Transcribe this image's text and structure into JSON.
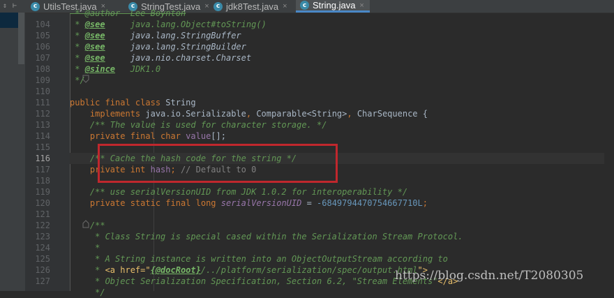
{
  "tabs": [
    {
      "label": "UtilsTest.java",
      "active": false
    },
    {
      "label": "StringTest.java",
      "active": false
    },
    {
      "label": "jdk8Test.java",
      "active": false
    },
    {
      "label": "String.java",
      "active": true
    }
  ],
  "toolstrip": {
    "icons": [
      "collapse-icon",
      "pin-icon"
    ]
  },
  "editor": {
    "current_line": "116",
    "lines": [
      {
        "n": "104"
      },
      {
        "n": "105"
      },
      {
        "n": "106"
      },
      {
        "n": "107"
      },
      {
        "n": "108"
      },
      {
        "n": "109"
      },
      {
        "n": "110"
      },
      {
        "n": "111"
      },
      {
        "n": "112"
      },
      {
        "n": "113"
      },
      {
        "n": "114"
      },
      {
        "n": "115"
      },
      {
        "n": "116"
      },
      {
        "n": "117"
      },
      {
        "n": "118"
      },
      {
        "n": "119"
      },
      {
        "n": "120"
      },
      {
        "n": "121"
      },
      {
        "n": "122"
      },
      {
        "n": "123"
      },
      {
        "n": "124"
      },
      {
        "n": "125"
      },
      {
        "n": "126"
      },
      {
        "n": "127"
      }
    ],
    "code": {
      "l103": " * @author  Lee Boynton",
      "l104a": " * ",
      "l104b": "@see",
      "l104c": "     java.lang.Object#",
      "l104d": "toString()",
      "l105a": " * ",
      "l105b": "@see",
      "l105c": "     java.lang.StringBuffer",
      "l106a": " * ",
      "l106b": "@see",
      "l106c": "     java.lang.StringBuilder",
      "l107a": " * ",
      "l107b": "@see",
      "l107c": "     java.nio.charset.Charset",
      "l108a": " * ",
      "l108b": "@since",
      "l108c": "   JDK1.0",
      "l109": " */",
      "l111a": "public final class ",
      "l111b": "String",
      "l112a": "    implements ",
      "l112b": "java.io.Serializable",
      "l112c": ", ",
      "l112d": "Comparable<String>",
      "l112e": ", ",
      "l112f": "CharSequence {",
      "l113": "    /** The value is used for character storage. */",
      "l114a": "    private final char ",
      "l114b": "value",
      "l114c": "[];",
      "l116": "    /** Cache the hash code for the string */",
      "l117a": "    private int ",
      "l117b": "hash",
      "l117c": "; ",
      "l117d": "// Default to 0",
      "l119": "    /** use serialVersionUID from JDK 1.0.2 for interoperability */",
      "l120a": "    private static final long ",
      "l120b": "serialVersionUID",
      "l120c": " = ",
      "l120d": "-6849794470754667710L",
      "l120e": ";",
      "l122": "    /**",
      "l123": "     * Class String is special cased within the Serialization Stream Protocol.",
      "l124": "     *",
      "l125": "     * A String instance is written into an ObjectOutputStream according to",
      "l126a": "     * ",
      "l126b": "<a href=\"",
      "l126c": "{@docRoot}",
      "l126d": "/../platform/serialization/spec/output.html",
      "l126e": "\">",
      "l127a": "     * Object Serialization Specification, Section 6.2, \"Stream Elements\"",
      "l127b": "</a>",
      "l128": "     */"
    }
  },
  "watermark": "https://blog.csdn.net/T2080305",
  "colors": {
    "highlight_box": "#c0272d",
    "keyword": "#cc7832",
    "doc_comment": "#629755",
    "field": "#9876aa",
    "number": "#6897bb",
    "tab_underline": "#4a88c7"
  }
}
